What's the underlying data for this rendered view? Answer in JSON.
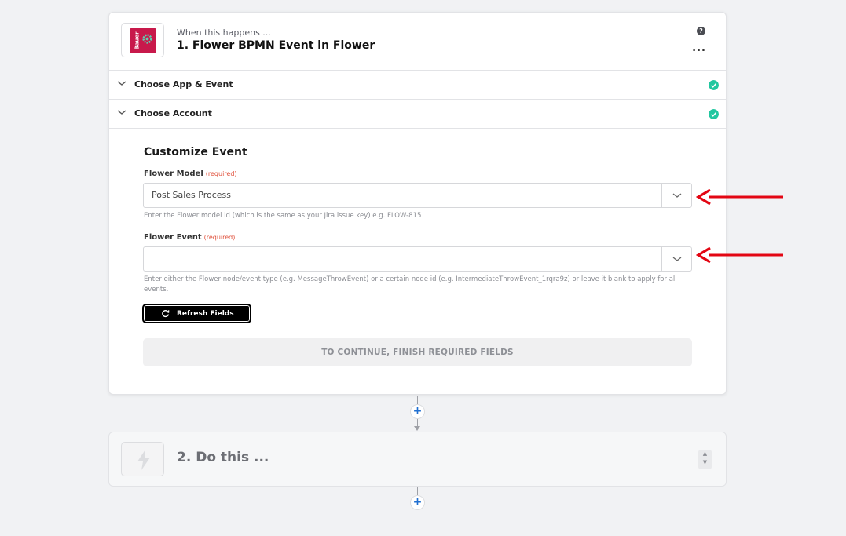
{
  "step1": {
    "subtitle": "When this happens ...",
    "title": "1. Flower BPMN Event in Flower",
    "app_logo_text": "Bauer",
    "more_label": "...",
    "help_label": "?"
  },
  "sections": [
    {
      "label": "Choose App & Event",
      "complete": true
    },
    {
      "label": "Choose Account",
      "complete": true
    }
  ],
  "customize": {
    "title": "Customize Event",
    "model": {
      "label": "Flower Model",
      "required": "(required)",
      "value": "Post Sales Process",
      "help": "Enter the Flower model id (which is the same as your Jira issue key) e.g. FLOW-815"
    },
    "event": {
      "label": "Flower Event",
      "required": "(required)",
      "value": "",
      "help": "Enter either the Flower node/event type (e.g. MessageThrowEvent) or a certain node id (e.g. IntermediateThrowEvent_1rqra9z) or leave it blank to apply for all events."
    },
    "refresh_label": "Refresh Fields",
    "continue_label": "TO CONTINUE, FINISH REQUIRED FIELDS"
  },
  "add_step_label": "+",
  "step2": {
    "title": "2. Do this ...",
    "stepper_up": "▲",
    "stepper_down": "▼"
  },
  "colors": {
    "accent": "#1f6fd1",
    "check": "#22c7a0",
    "annotation_arrow": "#e30613",
    "app_brand": "#c8194b"
  }
}
